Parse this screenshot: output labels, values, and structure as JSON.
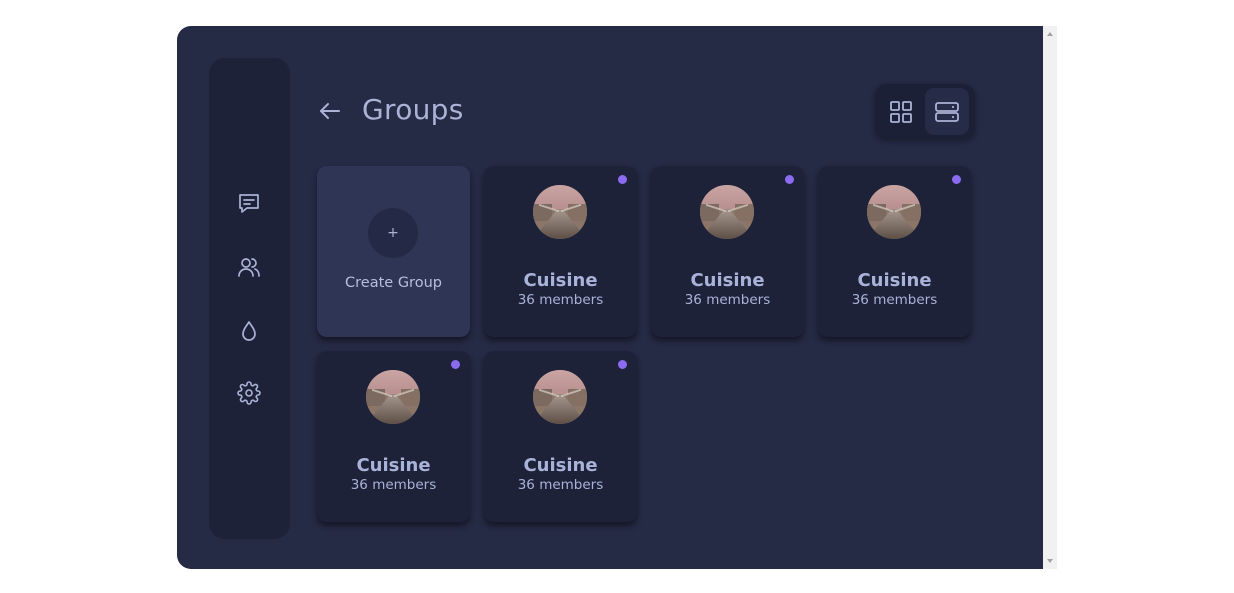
{
  "page": {
    "title": "Groups"
  },
  "sidebar": {
    "items": [
      {
        "icon": "chat-icon",
        "label": "Messages"
      },
      {
        "icon": "users-icon",
        "label": "Groups"
      },
      {
        "icon": "drop-icon",
        "label": "Theme"
      },
      {
        "icon": "gear-icon",
        "label": "Settings"
      }
    ]
  },
  "view_toggle": {
    "options": [
      "grid-view-icon",
      "list-view-icon"
    ],
    "selected": "list-view-icon"
  },
  "create_card": {
    "icon": "+",
    "label": "Create Group"
  },
  "groups": [
    {
      "name": "Cuisine",
      "members": "36 members",
      "unread": true
    },
    {
      "name": "Cuisine",
      "members": "36 members",
      "unread": true
    },
    {
      "name": "Cuisine",
      "members": "36 members",
      "unread": true
    },
    {
      "name": "Cuisine",
      "members": "36 members",
      "unread": true
    },
    {
      "name": "Cuisine",
      "members": "36 members",
      "unread": true
    }
  ],
  "colors": {
    "app_background": "#252a45",
    "sidebar_background": "#1e2238",
    "card_background": "#1e2238",
    "create_card_background": "#2f3655",
    "accent_dot": "#8b6cf0",
    "text": "#a9b3da"
  }
}
